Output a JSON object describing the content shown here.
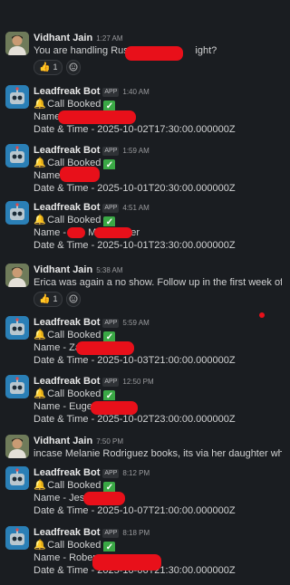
{
  "messages": [
    {
      "sender": "Vidhant Jain",
      "time": "1:27 AM",
      "lines": [
        "You are handling Russe",
        "ight?"
      ],
      "reaction": {
        "emoji": "👍",
        "count": "1"
      }
    },
    {
      "sender": "Leadfreak Bot",
      "app": "APP",
      "time": "1:40 AM",
      "status": "Call Booked",
      "name": "Name",
      "datetime": "Date & Time - 2025-10-02T17:30:00.000000Z"
    },
    {
      "sender": "Leadfreak Bot",
      "app": "APP",
      "time": "1:59 AM",
      "status": "Call Booked",
      "name": "Name -",
      "datetime": "Date & Time - 2025-10-01T20:30:00.000000Z"
    },
    {
      "sender": "Leadfreak Bot",
      "app": "APP",
      "time": "4:51 AM",
      "status": "Call Booked",
      "name": "Name -",
      "name2": "M",
      "name3": "er",
      "datetime": "Date & Time - 2025-10-01T23:30:00.000000Z"
    },
    {
      "sender": "Vidhant Jain",
      "time": "5:38 AM",
      "text": "Erica was again a no show. Follow up in the first week of Jan",
      "reaction": {
        "emoji": "👍",
        "count": "1"
      }
    },
    {
      "sender": "Leadfreak Bot",
      "app": "APP",
      "time": "5:59 AM",
      "status": "Call Booked",
      "name": "Name - Za",
      "datetime": "Date & Time - 2025-10-03T21:00:00.000000Z"
    },
    {
      "sender": "Leadfreak Bot",
      "app": "APP",
      "time": "12:50 PM",
      "status": "Call Booked",
      "name": "Name - Eugene",
      "datetime": "Date & Time - 2025-10-02T23:00:00.000000Z"
    },
    {
      "sender": "Vidhant Jain",
      "time": "7:50 PM",
      "text": "incase Melanie Rodriguez books, its via her daughter who we"
    },
    {
      "sender": "Leadfreak Bot",
      "app": "APP",
      "time": "8:12 PM",
      "status": "Call Booked",
      "name": "Name - Jess",
      "datetime": "Date & Time - 2025-10-07T21:00:00.000000Z"
    },
    {
      "sender": "Leadfreak Bot",
      "app": "APP",
      "time": "8:18 PM",
      "status": "Call Booked",
      "name": "Name - Rober",
      "datetime": "Date & Time - 2025-10-06T21:30:00.000000Z"
    }
  ]
}
